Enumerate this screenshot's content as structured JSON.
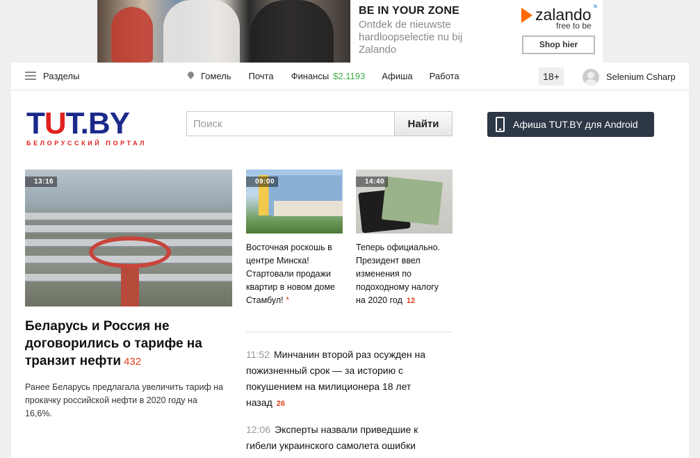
{
  "ad": {
    "headline": "BE IN YOUR ZONE",
    "body": "Ontdek de nieuwste hardloopselectie nu bij Zalando",
    "brand": "zalando",
    "tagline": "free to be",
    "cta": "Shop hier",
    "close": "×",
    "brand_color": "#ff6900"
  },
  "nav": {
    "sections": "Разделы",
    "city": "Гомель",
    "mail": "Почта",
    "finance": "Финансы",
    "rate": "$2.1193",
    "afisha": "Афиша",
    "jobs": "Работа",
    "age": "18+",
    "user": "Selenium Csharp"
  },
  "header": {
    "logo_main_1": "T",
    "logo_main_2": "U",
    "logo_main_3": "T.BY",
    "logo_sub": "БЕЛОРУССКИЙ ПОРТАЛ",
    "search_placeholder": "Поиск",
    "search_button": "Найти",
    "android_button": "Афиша TUT.BY для Android"
  },
  "main_story": {
    "time": "13:16",
    "title": "Беларусь и Россия не договорились о тарифе на транзит нефти",
    "comments": "432",
    "lead": "Ранее Беларусь предлагала увеличить тариф на прокачку российской нефти в 2020 году на 16,6%."
  },
  "cards": [
    {
      "time": "09:00",
      "title": "Восточная роскошь в центре Минска! Стартовали продажи квартир в новом доме Стамбул!",
      "marker": "*"
    },
    {
      "time": "14:40",
      "title": "Теперь официально. Президент ввел изменения по подоходному налогу на 2020 год",
      "comments": "12"
    }
  ],
  "feed": [
    {
      "time": "11:52",
      "title": "Минчанин второй раз осужден на пожизненный срок — за историю с покушением на милиционера 18 лет назад",
      "comments": "26"
    },
    {
      "time": "12:06",
      "title": "Эксперты назвали приведшие к гибели украинского самолета ошибки"
    }
  ],
  "colors": {
    "logo_blue": "#1b2a8a",
    "logo_red": "#e0201d",
    "rate_green": "#3fae49",
    "count_red": "#e0401d",
    "android_bg": "#2d3746"
  }
}
